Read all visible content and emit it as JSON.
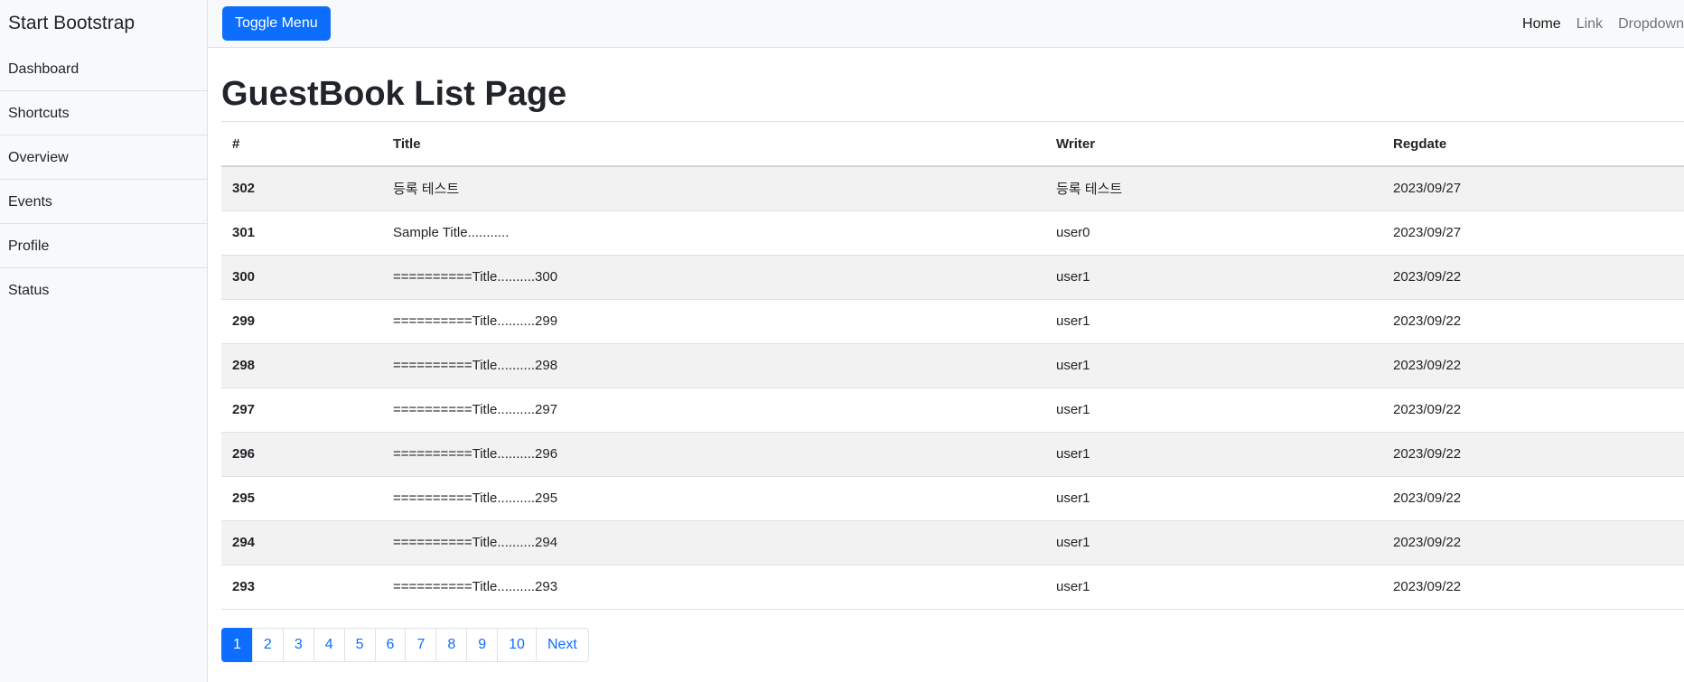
{
  "sidebar": {
    "heading": "Start Bootstrap",
    "items": [
      {
        "label": "Dashboard"
      },
      {
        "label": "Shortcuts"
      },
      {
        "label": "Overview"
      },
      {
        "label": "Events"
      },
      {
        "label": "Profile"
      },
      {
        "label": "Status"
      }
    ]
  },
  "topbar": {
    "toggle_label": "Toggle Menu",
    "nav": [
      {
        "label": "Home"
      },
      {
        "label": "Link"
      },
      {
        "label": "Dropdown"
      }
    ]
  },
  "page": {
    "title": "GuestBook List Page"
  },
  "table": {
    "headers": {
      "no": "#",
      "title": "Title",
      "writer": "Writer",
      "regdate": "Regdate"
    },
    "rows": [
      {
        "no": "302",
        "title": "등록 테스트",
        "writer": "등록 테스트",
        "regdate": "2023/09/27"
      },
      {
        "no": "301",
        "title": "Sample Title...........",
        "writer": "user0",
        "regdate": "2023/09/27"
      },
      {
        "no": "300",
        "title": "==========Title..........300",
        "writer": "user1",
        "regdate": "2023/09/22"
      },
      {
        "no": "299",
        "title": "==========Title..........299",
        "writer": "user1",
        "regdate": "2023/09/22"
      },
      {
        "no": "298",
        "title": "==========Title..........298",
        "writer": "user1",
        "regdate": "2023/09/22"
      },
      {
        "no": "297",
        "title": "==========Title..........297",
        "writer": "user1",
        "regdate": "2023/09/22"
      },
      {
        "no": "296",
        "title": "==========Title..........296",
        "writer": "user1",
        "regdate": "2023/09/22"
      },
      {
        "no": "295",
        "title": "==========Title..........295",
        "writer": "user1",
        "regdate": "2023/09/22"
      },
      {
        "no": "294",
        "title": "==========Title..........294",
        "writer": "user1",
        "regdate": "2023/09/22"
      },
      {
        "no": "293",
        "title": "==========Title..........293",
        "writer": "user1",
        "regdate": "2023/09/22"
      }
    ]
  },
  "pagination": {
    "pages": [
      "1",
      "2",
      "3",
      "4",
      "5",
      "6",
      "7",
      "8",
      "9",
      "10"
    ],
    "active": "1",
    "next_label": "Next"
  },
  "colors": {
    "primary": "#0d6efd",
    "sidebar_bg": "#f8f9fa",
    "stripe": "#f2f2f2",
    "border": "#dee2e6"
  }
}
